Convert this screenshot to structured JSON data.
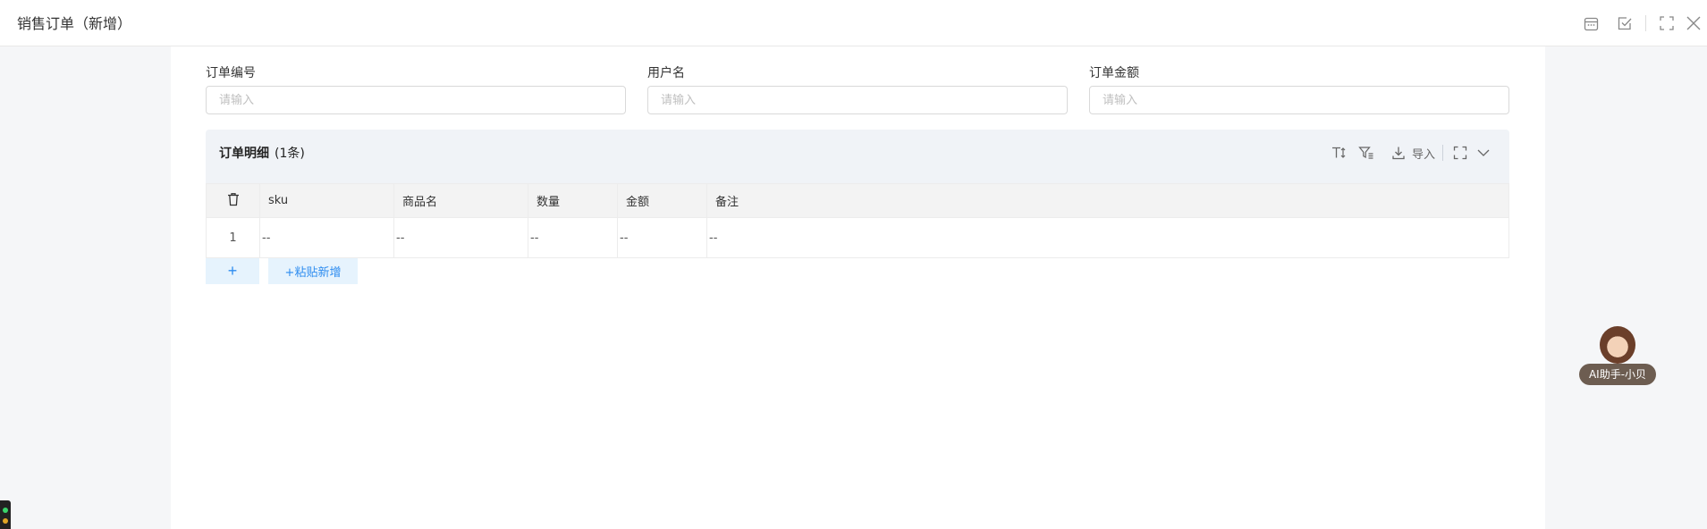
{
  "header": {
    "title": "销售订单（新增）",
    "icons": [
      "calendar-icon",
      "check-square-icon",
      "fullscreen-icon",
      "close-icon"
    ]
  },
  "form": {
    "order_no": {
      "label": "订单编号",
      "placeholder": "请输入",
      "value": ""
    },
    "username": {
      "label": "用户名",
      "placeholder": "请输入",
      "value": ""
    },
    "amount": {
      "label": "订单金额",
      "placeholder": "请输入",
      "value": ""
    }
  },
  "detail": {
    "title": "订单明细",
    "count": "(1条)",
    "toolbar": {
      "import_label": "导入"
    },
    "columns": [
      "sku",
      "商品名",
      "数量",
      "金额",
      "备注"
    ],
    "rows": [
      {
        "index": "1",
        "sku": "--",
        "name": "--",
        "qty": "--",
        "amount": "--",
        "remark": "--"
      }
    ]
  },
  "actions": {
    "add_label": "+",
    "paste_label": "+粘贴新增"
  },
  "assistant": {
    "label": "AI助手-小贝"
  },
  "colors": {
    "accent": "#2d8cf0",
    "panel_bg": "#f0f3f7",
    "page_bg": "#f5f6f8"
  }
}
